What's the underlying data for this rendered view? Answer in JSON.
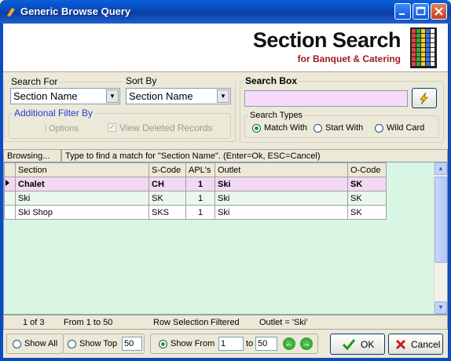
{
  "window": {
    "title": "Generic Browse Query"
  },
  "header": {
    "title": "Section Search",
    "subtitle": "for Banquet & Catering",
    "logo_icon": "grid-logo-icon"
  },
  "search_for": {
    "legend": "Search For",
    "value": "Section Name"
  },
  "sort_by": {
    "legend": "Sort By",
    "value": "Section Name"
  },
  "additional_filter": {
    "legend": "Additional Filter By",
    "options_label": "Options",
    "view_deleted_label": "View Deleted Records"
  },
  "search_box": {
    "legend": "Search Box",
    "value": "",
    "go_icon": "lightning-icon"
  },
  "search_types": {
    "legend": "Search Types",
    "options": [
      "Match With",
      "Start With",
      "Wild Card"
    ],
    "selected": "Match With"
  },
  "status": {
    "left": "Browsing...",
    "message": "Type to find a match for \"Section Name\". (Enter=Ok, ESC=Cancel)"
  },
  "grid": {
    "columns": [
      "Section",
      "S-Code",
      "APL's",
      "Outlet",
      "O-Code"
    ],
    "rows": [
      [
        "Chalet",
        "CH",
        "1",
        "Ski",
        "SK"
      ],
      [
        "Ski",
        "SK",
        "1",
        "Ski",
        "SK"
      ],
      [
        "Ski Shop",
        "SKS",
        "1",
        "Ski",
        "SK"
      ]
    ]
  },
  "footer_info": {
    "position": "1 of 3",
    "range": "From 1 to 50",
    "mode": "Row Selection",
    "filtered": "Filtered",
    "filter_expr": "Outlet = 'Ski'"
  },
  "bottom": {
    "show_all": "Show All",
    "show_top": "Show Top",
    "show_top_value": "50",
    "show_from": "Show From",
    "from_value": "1",
    "to_label": "to",
    "to_value": "50",
    "ok": "OK",
    "cancel": "Cancel"
  },
  "colors": {
    "title_bar": "#0a4cc2",
    "selected_row": "#f2d8f2",
    "grid_bg": "#d9f5e3",
    "search_input": "#f6dcf8",
    "brand_red": "#9b1b1b"
  }
}
